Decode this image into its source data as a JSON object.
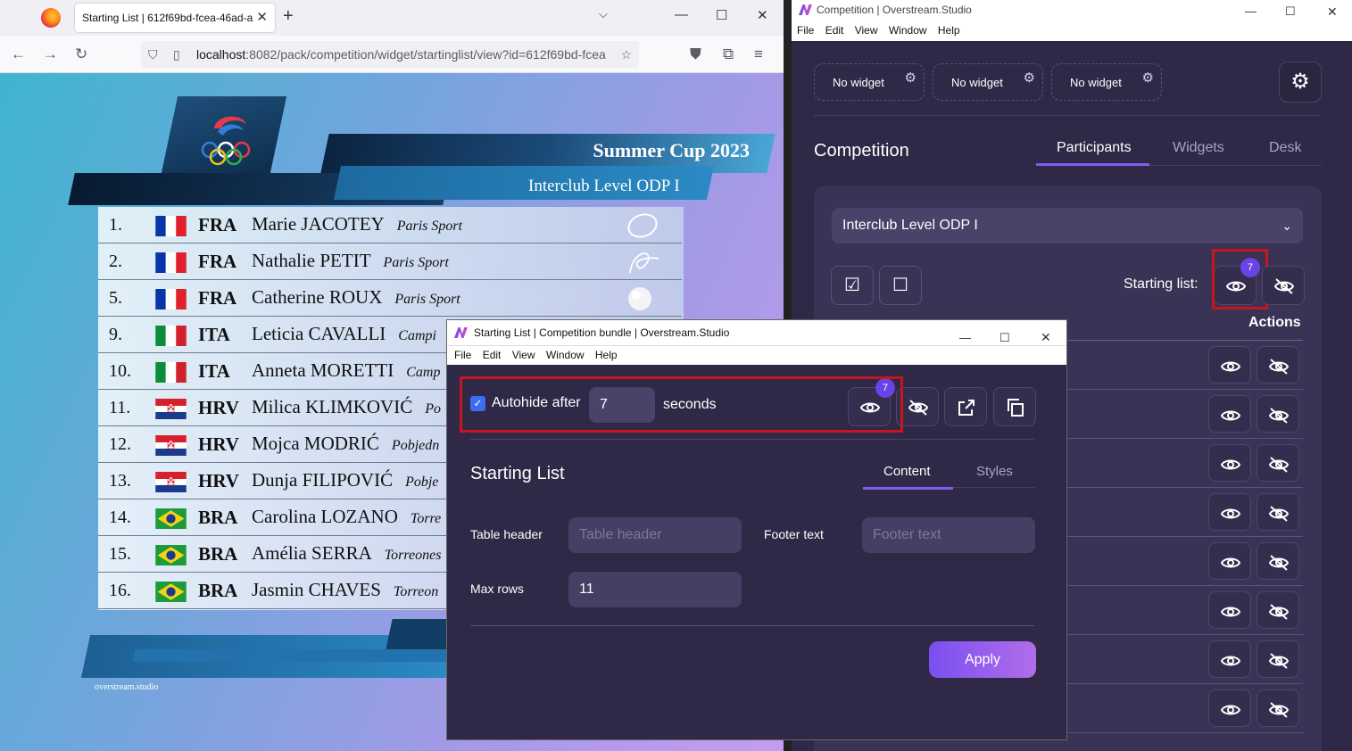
{
  "browser": {
    "tab_title": "Starting List | 612f69bd-fcea-46ad-a",
    "url_host": "localhost",
    "url_rest": ":8082/pack/competition/widget/startinglist/view?id=612f69bd-fcea"
  },
  "overlay": {
    "title": "Summer Cup 2023",
    "subtitle": "Interclub Level ODP I",
    "footer": "overstream.studio",
    "rows": [
      {
        "num": "1.",
        "nat": "FRA",
        "name": "Marie JACOTEY",
        "club": "Paris Sport",
        "flag": "fra",
        "apparatus": "hoop"
      },
      {
        "num": "2.",
        "nat": "FRA",
        "name": "Nathalie PETIT",
        "club": "Paris Sport",
        "flag": "fra",
        "apparatus": "ribbon"
      },
      {
        "num": "5.",
        "nat": "FRA",
        "name": "Catherine ROUX",
        "club": "Paris Sport",
        "flag": "fra",
        "apparatus": "ball"
      },
      {
        "num": "9.",
        "nat": "ITA",
        "name": "Leticia CAVALLI",
        "club": "Campi",
        "flag": "ita",
        "apparatus": ""
      },
      {
        "num": "10.",
        "nat": "ITA",
        "name": "Anneta MORETTI",
        "club": "Camp",
        "flag": "ita",
        "apparatus": ""
      },
      {
        "num": "11.",
        "nat": "HRV",
        "name": "Milica KLIMKOVIĆ",
        "club": "Po",
        "flag": "hrv",
        "apparatus": ""
      },
      {
        "num": "12.",
        "nat": "HRV",
        "name": "Mojca MODRIĆ",
        "club": "Pobjedn",
        "flag": "hrv",
        "apparatus": ""
      },
      {
        "num": "13.",
        "nat": "HRV",
        "name": "Dunja FILIPOVIĆ",
        "club": "Pobje",
        "flag": "hrv",
        "apparatus": ""
      },
      {
        "num": "14.",
        "nat": "BRA",
        "name": "Carolina LOZANO",
        "club": "Torre",
        "flag": "bra",
        "apparatus": ""
      },
      {
        "num": "15.",
        "nat": "BRA",
        "name": "Amélia SERRA",
        "club": "Torreones",
        "flag": "bra",
        "apparatus": ""
      },
      {
        "num": "16.",
        "nat": "BRA",
        "name": "Jasmin CHAVES",
        "club": "Torreon",
        "flag": "bra",
        "apparatus": ""
      }
    ]
  },
  "studio": {
    "window_title": "Competition | Overstream.Studio",
    "menu": [
      "File",
      "Edit",
      "View",
      "Window",
      "Help"
    ],
    "widgets": [
      "No widget",
      "No widget",
      "No widget"
    ],
    "heading": "Competition",
    "tabs": [
      "Participants",
      "Widgets",
      "Desk"
    ],
    "selected_level": "Interclub Level ODP I",
    "starting_list_label": "Starting list:",
    "badge": "7",
    "actions_header": "Actions"
  },
  "dialog": {
    "window_title": "Starting List | Competition bundle | Overstream.Studio",
    "menu": [
      "File",
      "Edit",
      "View",
      "Window",
      "Help"
    ],
    "autohide_label": "Autohide after",
    "autohide_value": "7",
    "seconds_label": "seconds",
    "badge": "7",
    "heading": "Starting List",
    "tabs": [
      "Content",
      "Styles"
    ],
    "table_header_label": "Table header",
    "table_header_placeholder": "Table header",
    "footer_text_label": "Footer text",
    "footer_text_placeholder": "Footer text",
    "max_rows_label": "Max rows",
    "max_rows_value": "11",
    "apply_label": "Apply"
  }
}
